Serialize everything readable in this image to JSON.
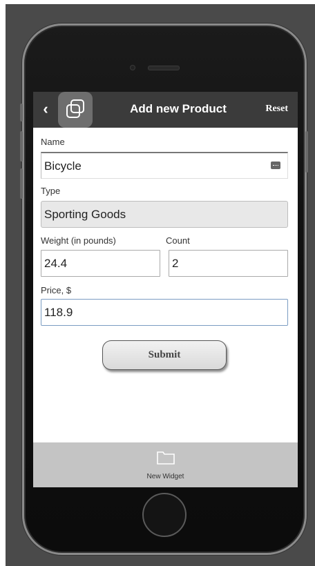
{
  "header": {
    "title": "Add new Product",
    "reset_label": "Reset",
    "back_icon": "‹",
    "app_icon": "overlapping-squares-icon"
  },
  "form": {
    "name_label": "Name",
    "name_value": "Bicycle",
    "type_label": "Type",
    "type_value": "Sporting Goods",
    "weight_label": "Weight (in pounds)",
    "weight_value": "24.4",
    "count_label": "Count",
    "count_value": "2",
    "price_label": "Price, $",
    "price_value": "118.9",
    "submit_label": "Submit"
  },
  "tabbar": {
    "new_widget_label": "New Widget",
    "new_widget_icon": "folder-icon"
  },
  "colors": {
    "topbar": "#3b3b3b",
    "tabbar": "#c4c4c4",
    "price_focus_border": "#7a9cc2"
  }
}
